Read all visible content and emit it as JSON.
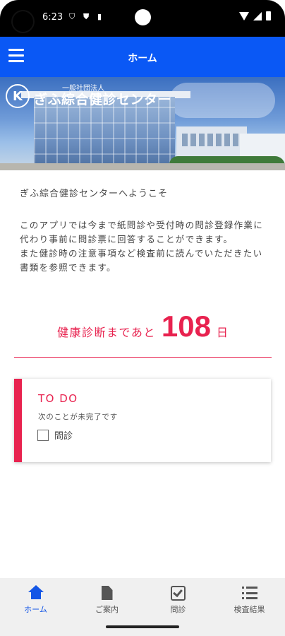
{
  "status_bar": {
    "time": "6:23"
  },
  "app_bar": {
    "title": "ホーム"
  },
  "banner": {
    "logo_sub": "一般社団法人",
    "logo_main": "ぎふ綜合健診センター"
  },
  "main": {
    "welcome": "ぎふ綜合健診センターへようこそ",
    "description": [
      "このアプリでは今まで紙問診や受付時の問診登録作業に代わり事前に問診票に回答することができます。",
      "また健診時の注意事項など検査前に読んでいただきたい書類を参照できます。"
    ],
    "countdown": {
      "prefix": "健康診断まであと",
      "days": "108",
      "suffix": "日"
    }
  },
  "todo": {
    "title": "TO DO",
    "subtitle": "次のことが未完了です",
    "items": [
      {
        "label": "問診",
        "checked": false
      }
    ]
  },
  "bottom_nav": {
    "items": [
      {
        "label": "ホーム",
        "icon": "home-icon",
        "active": true
      },
      {
        "label": "ご案内",
        "icon": "document-icon",
        "active": false
      },
      {
        "label": "問診",
        "icon": "checkbox-icon",
        "active": false
      },
      {
        "label": "検査結果",
        "icon": "list-icon",
        "active": false
      }
    ]
  },
  "colors": {
    "app_bar": "#0a58f5",
    "accent": "#e8224f",
    "nav_active": "#1456e6"
  }
}
